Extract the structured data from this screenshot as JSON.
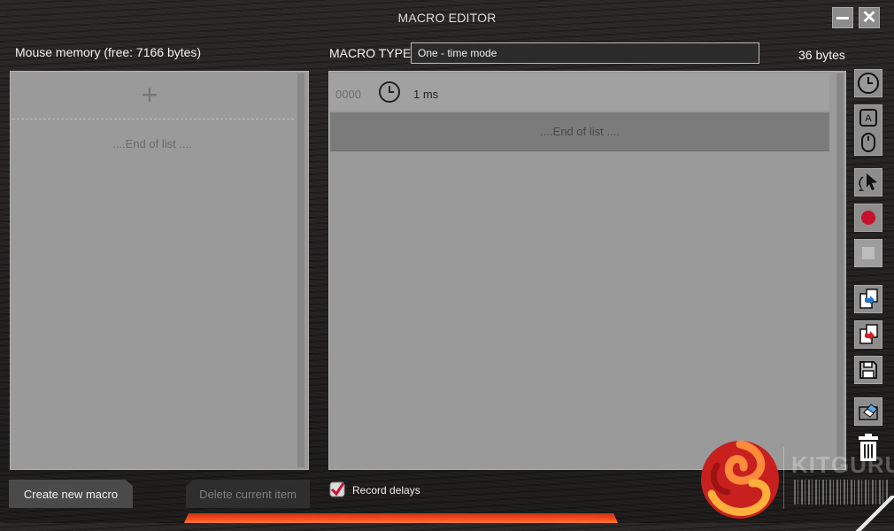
{
  "window": {
    "title": "MACRO EDITOR"
  },
  "header": {
    "memory_label": "Mouse memory (free: 7166 bytes)",
    "macro_type_label": "MACRO TYPE",
    "macro_type_value": "One - time mode",
    "bytes_label": "36 bytes"
  },
  "left_list": {
    "end_of_list": "....End of list ...."
  },
  "macro_list": {
    "rows": [
      {
        "index": "0000",
        "icon": "clock-icon",
        "value": "1 ms"
      }
    ],
    "end_of_list": "....End of list ...."
  },
  "toolbar": {
    "tools": [
      "clock-icon",
      "keyboard-mouse-icon",
      "mouse-move-icon",
      "record-icon",
      "stop-icon",
      "import-icon",
      "export-icon",
      "save-icon",
      "eraser-icon",
      "trash-icon"
    ],
    "key_letter": "A"
  },
  "footer": {
    "create_label": "Create new macro",
    "delete_label": "Delete current item",
    "record_delays_label": "Record delays",
    "record_delays_checked": true,
    "watermark": "KITGURU"
  },
  "colors": {
    "accent_red": "#c8102e",
    "panel_gray": "#9a9a9a",
    "selected_row": "#7b7b7b"
  }
}
